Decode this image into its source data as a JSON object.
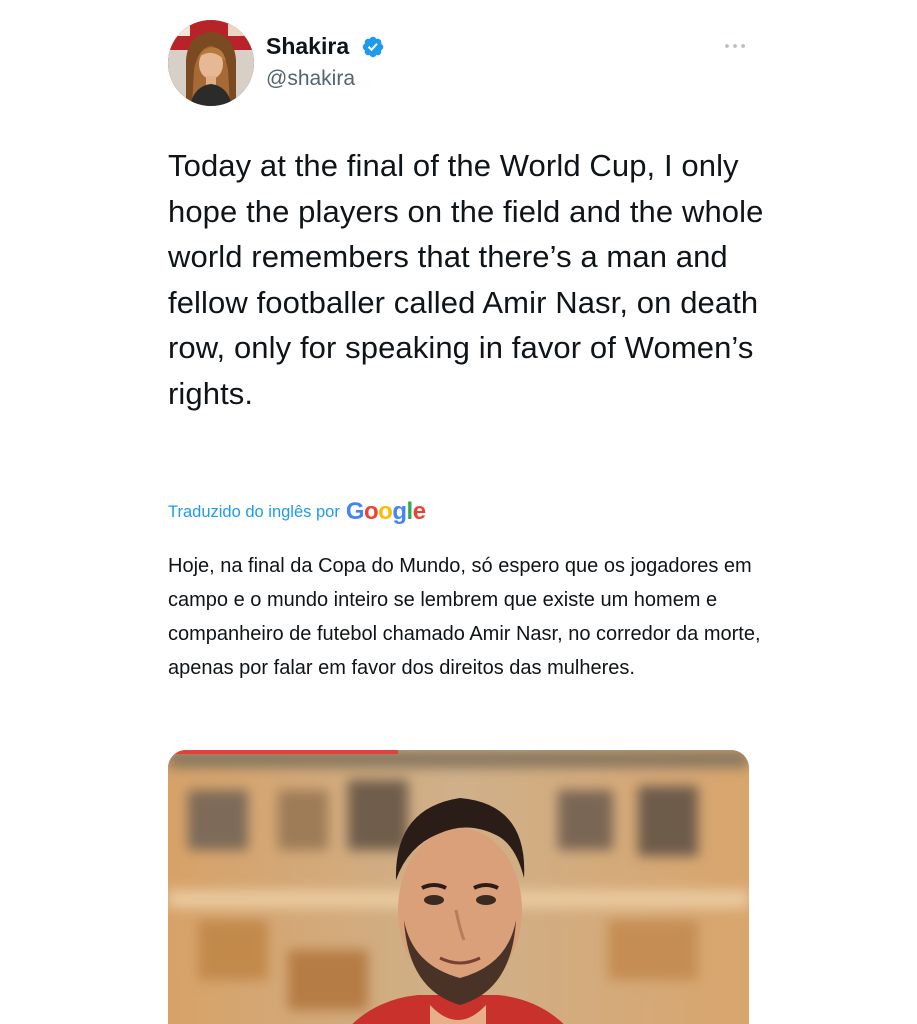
{
  "author": {
    "display_name": "Shakira",
    "handle": "@shakira",
    "verified": true,
    "avatar_icon": "profile-photo",
    "verified_icon": "verified-badge-icon"
  },
  "menu": {
    "more_icon": "more-options-icon"
  },
  "tweet": {
    "text": "Today at the final of the World Cup, I only hope the players on the field and the whole world remembers that there’s a man and fellow footballer called Amir Nasr, on death row, only for speaking in favor of Women’s rights."
  },
  "translation": {
    "label": "Traduzido do inglês por",
    "provider": "Google",
    "text": "Hoje, na final da Copa do Mundo, só espero que os jogadores em campo e o mundo inteiro se lembrem que existe um homem e companheiro de futebol chamado Amir Nasr, no corredor da morte, apenas por falar em favor dos direitos das mulheres."
  },
  "colors": {
    "link_blue": "#1d9bf0",
    "secondary_text": "#536471",
    "google_blue": "#4285F4",
    "google_red": "#EA4335",
    "google_yellow": "#FBBC05",
    "google_green": "#34A853"
  }
}
